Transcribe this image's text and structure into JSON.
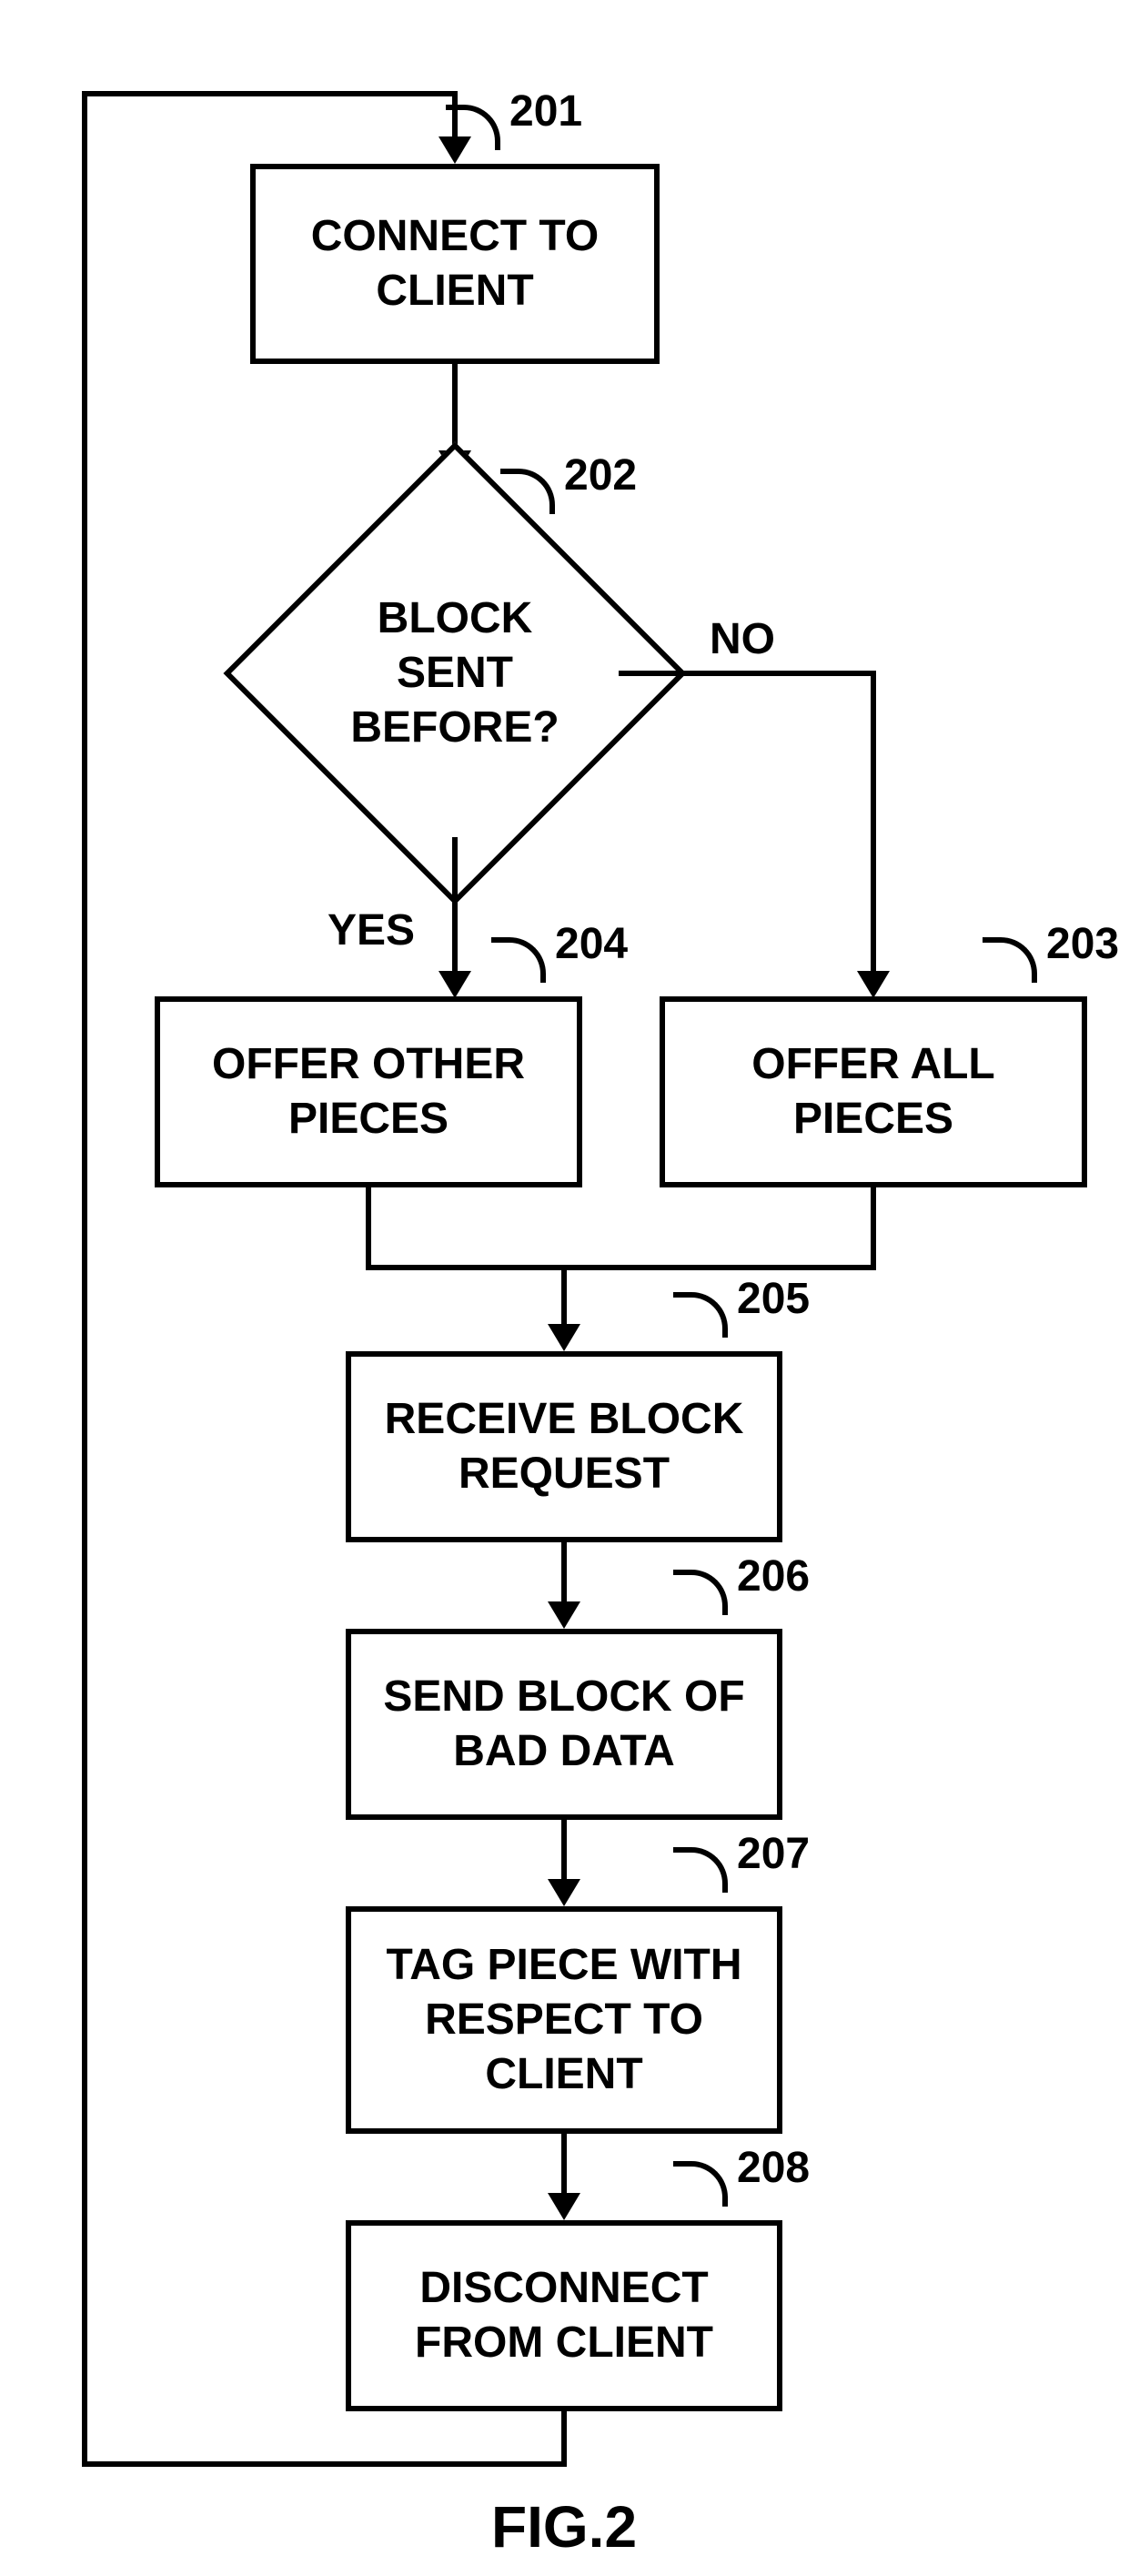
{
  "figure_caption": "FIG.2",
  "refs": {
    "r201": "201",
    "r202": "202",
    "r203": "203",
    "r204": "204",
    "r205": "205",
    "r206": "206",
    "r207": "207",
    "r208": "208"
  },
  "nodes": {
    "connect": "CONNECT TO\nCLIENT",
    "decision": "BLOCK\nSENT\nBEFORE?",
    "offer_other": "OFFER OTHER\nPIECES",
    "offer_all": "OFFER ALL\nPIECES",
    "receive": "RECEIVE BLOCK\nREQUEST",
    "send_bad": "SEND BLOCK OF\nBAD DATA",
    "tag": "TAG PIECE WITH\nRESPECT TO\nCLIENT",
    "disconnect": "DISCONNECT\nFROM CLIENT"
  },
  "edges": {
    "yes": "YES",
    "no": "NO"
  },
  "chart_data": {
    "type": "flowchart",
    "nodes": [
      {
        "id": "201",
        "shape": "process",
        "text": "CONNECT TO CLIENT"
      },
      {
        "id": "202",
        "shape": "decision",
        "text": "BLOCK SENT BEFORE?"
      },
      {
        "id": "203",
        "shape": "process",
        "text": "OFFER ALL PIECES"
      },
      {
        "id": "204",
        "shape": "process",
        "text": "OFFER OTHER PIECES"
      },
      {
        "id": "205",
        "shape": "process",
        "text": "RECEIVE BLOCK REQUEST"
      },
      {
        "id": "206",
        "shape": "process",
        "text": "SEND BLOCK OF BAD DATA"
      },
      {
        "id": "207",
        "shape": "process",
        "text": "TAG PIECE WITH RESPECT TO CLIENT"
      },
      {
        "id": "208",
        "shape": "process",
        "text": "DISCONNECT FROM CLIENT"
      }
    ],
    "edges": [
      {
        "from": "201",
        "to": "202"
      },
      {
        "from": "202",
        "to": "204",
        "label": "YES"
      },
      {
        "from": "202",
        "to": "203",
        "label": "NO"
      },
      {
        "from": "204",
        "to": "205"
      },
      {
        "from": "203",
        "to": "205"
      },
      {
        "from": "205",
        "to": "206"
      },
      {
        "from": "206",
        "to": "207"
      },
      {
        "from": "207",
        "to": "208"
      },
      {
        "from": "208",
        "to": "201",
        "note": "loop back"
      }
    ]
  }
}
